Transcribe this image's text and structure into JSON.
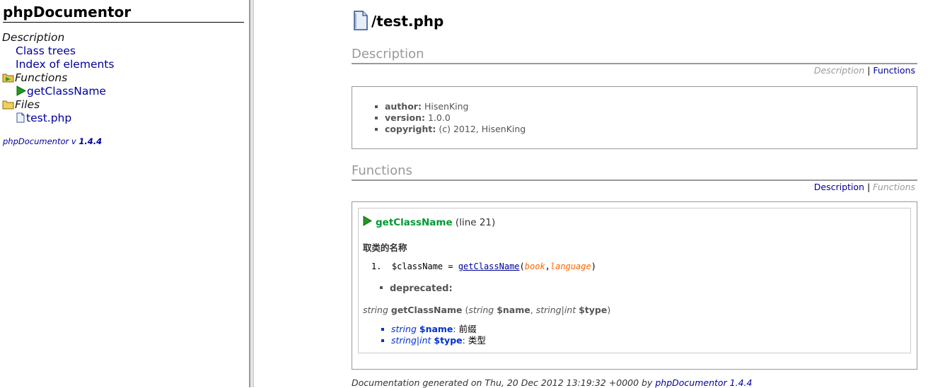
{
  "left_panel": {
    "title": "phpDocumentor",
    "tree": {
      "description_heading": "Description",
      "class_trees": "Class trees",
      "index_of_elements": "Index of elements",
      "functions_heading": "Functions",
      "function_item": "getClassName",
      "files_heading": "Files",
      "file_item": "test.php"
    },
    "generator_prefix": "phpDocumentor v",
    "generator_version": "1.4.4"
  },
  "main": {
    "file_title": "/test.php",
    "description_section": {
      "title": "Description",
      "nav_current": "Description",
      "nav_sep": "|",
      "nav_link": "Functions",
      "tags": [
        {
          "label": "author:",
          "value": "HisenKing"
        },
        {
          "label": "version:",
          "value": "1.0.0"
        },
        {
          "label": "copyright:",
          "value": "(c) 2012, HisenKing"
        }
      ]
    },
    "functions_section": {
      "title": "Functions",
      "nav_link": "Description",
      "nav_sep": "|",
      "nav_current": "Functions",
      "function": {
        "name": "getClassName",
        "line": "(line 21)",
        "description": "取类的名称",
        "example": {
          "line_number": "1.",
          "code_prefix": "$className = ",
          "link": "getClassName",
          "open": "(",
          "arg1": "book",
          "comma": ",",
          "arg2": "language",
          "close": ")"
        },
        "deprecated_label": "deprecated:",
        "signature": {
          "return_type": "string",
          "name": "getClassName",
          "open": "(",
          "p1_type": "string",
          "p1_name": "$name",
          "comma": ",",
          "p2_type_a": "string",
          "p2_bar": "|",
          "p2_type_b": "int",
          "p2_name": "$type",
          "close": ")"
        },
        "params": [
          {
            "type": "string",
            "name": "$name",
            "desc": "前缀"
          },
          {
            "type": "string|int",
            "name": "$type",
            "desc": "类型"
          }
        ]
      }
    },
    "footer": {
      "text": "Documentation generated on Thu, 20 Dec 2012 13:19:32 +0000 by",
      "link": "phpDocumentor 1.4.4"
    }
  }
}
